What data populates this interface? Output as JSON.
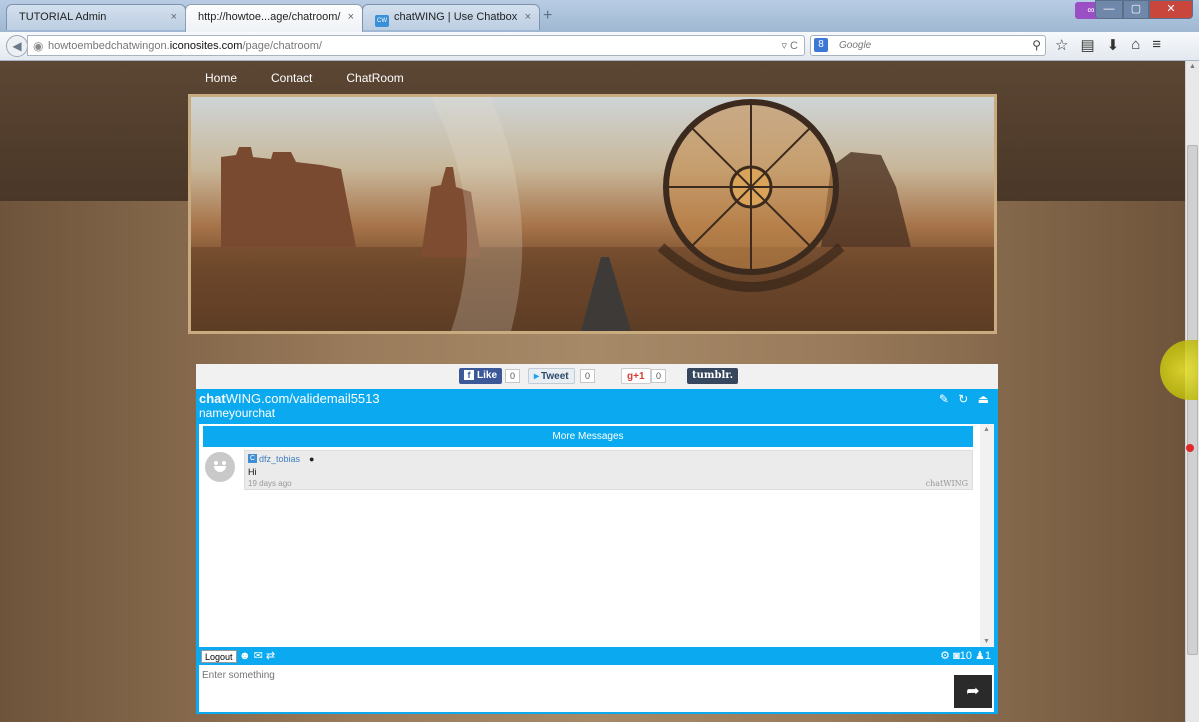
{
  "browser": {
    "tabs": [
      {
        "label": "TUTORIAL Admin",
        "active": false
      },
      {
        "label": "http://howtoe...age/chatroom/",
        "active": true
      },
      {
        "label": "chatWING | Use Chatbox",
        "active": false
      }
    ],
    "tab_close": "×",
    "new_tab": "+",
    "url_prefix": "howtoembedchatwingon.",
    "url_domain": "iconosites.com",
    "url_path": "/page/chatroom/",
    "url_tools": "▿ C",
    "search_placeholder": "Google",
    "search_engine": "8",
    "mask_icon": "∞",
    "window_buttons": {
      "min": "—",
      "max": "▢",
      "close": "✕"
    },
    "nav_icons": {
      "back": "◀",
      "bookmark": "☆",
      "reader": "▤",
      "downloads": "⬇",
      "home": "⌂",
      "menu": "≡",
      "search": "⚲",
      "globe": "◉"
    }
  },
  "site": {
    "nav": [
      "Home",
      "Contact",
      "ChatRoom"
    ]
  },
  "social": {
    "like_label": "Like",
    "like_count": "0",
    "tweet_label": "Tweet",
    "tweet_count": "0",
    "gplus_label": "g+1",
    "gplus_count": "0",
    "tumblr_label": "tumblr."
  },
  "chatbox": {
    "url_bold": "chat",
    "url_rest": "WING.com/validemail5513",
    "chat_name": "nameyourchat",
    "tools": "✎ ↻ ⏏",
    "more_messages": "More Messages",
    "messages": [
      {
        "user": "dfz_tobias",
        "text": "Hi",
        "time": "19 days ago",
        "brand": "chatWING"
      }
    ],
    "logout_label": "Logout",
    "bar_icons_left": "☻ ✉ ⇄",
    "bar_right": "⚙ ◙10 ♟1",
    "input_placeholder": "Enter something",
    "send_icon": "➦",
    "scroll_up": "▲",
    "scroll_down": "▼"
  }
}
